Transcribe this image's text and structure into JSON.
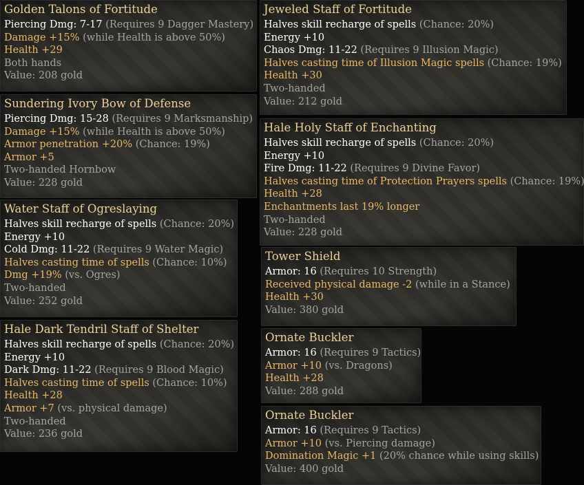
{
  "tooltips": [
    {
      "id": "golden-talons",
      "title": "Golden Talons of Fortitude",
      "lines": [
        [
          {
            "t": "Piercing Dmg: 7-17 ",
            "c": "w"
          },
          {
            "t": "(Requires 9 Dagger Mastery)",
            "c": "g"
          }
        ],
        [
          {
            "t": "Damage +15% ",
            "c": "o"
          },
          {
            "t": "(while Health is above 50%)",
            "c": "g"
          }
        ],
        [
          {
            "t": "Health +29",
            "c": "o"
          }
        ],
        [
          {
            "t": "Both hands",
            "c": "g"
          }
        ],
        [
          {
            "t": "Value: 208 gold",
            "c": "g"
          }
        ]
      ]
    },
    {
      "id": "sundering-ivory-bow",
      "title": "Sundering Ivory Bow of Defense",
      "lines": [
        [
          {
            "t": "Piercing Dmg: 15-28 ",
            "c": "w"
          },
          {
            "t": "(Requires 9 Marksmanship)",
            "c": "g"
          }
        ],
        [
          {
            "t": "Damage +15% ",
            "c": "o"
          },
          {
            "t": "(while Health is above 50%)",
            "c": "g"
          }
        ],
        [
          {
            "t": "Armor penetration +20% ",
            "c": "o"
          },
          {
            "t": "(Chance: 19%)",
            "c": "g"
          }
        ],
        [
          {
            "t": "Armor +5",
            "c": "o"
          }
        ],
        [
          {
            "t": "Two-handed Hornbow",
            "c": "g"
          }
        ],
        [
          {
            "t": "Value: 228 gold",
            "c": "g"
          }
        ]
      ]
    },
    {
      "id": "water-staff",
      "title": "Water Staff of Ogreslaying",
      "lines": [
        [
          {
            "t": "Halves skill recharge of spells ",
            "c": "w"
          },
          {
            "t": "(Chance: 20%)",
            "c": "g"
          }
        ],
        [
          {
            "t": "Energy +10",
            "c": "w"
          }
        ],
        [
          {
            "t": "Cold Dmg: 11-22 ",
            "c": "w"
          },
          {
            "t": "(Requires 9 Water Magic)",
            "c": "g"
          }
        ],
        [
          {
            "t": "Halves casting time of spells ",
            "c": "o"
          },
          {
            "t": "(Chance: 10%)",
            "c": "g"
          }
        ],
        [
          {
            "t": "Dmg +19% ",
            "c": "o"
          },
          {
            "t": "(vs. Ogres)",
            "c": "g"
          }
        ],
        [
          {
            "t": "Two-handed",
            "c": "g"
          }
        ],
        [
          {
            "t": "Value: 252 gold",
            "c": "g"
          }
        ]
      ]
    },
    {
      "id": "dark-tendril-staff",
      "title": "Hale Dark Tendril Staff of Shelter",
      "lines": [
        [
          {
            "t": "Halves skill recharge of spells ",
            "c": "w"
          },
          {
            "t": "(Chance: 20%)",
            "c": "g"
          }
        ],
        [
          {
            "t": "Energy +10",
            "c": "w"
          }
        ],
        [
          {
            "t": "Dark Dmg: 11-22 ",
            "c": "w"
          },
          {
            "t": "(Requires 9 Blood Magic)",
            "c": "g"
          }
        ],
        [
          {
            "t": "Halves casting time of spells ",
            "c": "o"
          },
          {
            "t": "(Chance: 10%)",
            "c": "g"
          }
        ],
        [
          {
            "t": "Health +28",
            "c": "o"
          }
        ],
        [
          {
            "t": "Armor +7 ",
            "c": "o"
          },
          {
            "t": "(vs. physical damage)",
            "c": "g"
          }
        ],
        [
          {
            "t": "Two-handed",
            "c": "g"
          }
        ],
        [
          {
            "t": "Value: 236 gold",
            "c": "g"
          }
        ]
      ]
    },
    {
      "id": "jeweled-staff",
      "title": "Jeweled Staff of Fortitude",
      "lines": [
        [
          {
            "t": "Halves skill recharge of spells ",
            "c": "w"
          },
          {
            "t": "(Chance: 20%)",
            "c": "g"
          }
        ],
        [
          {
            "t": "Energy +10",
            "c": "w"
          }
        ],
        [
          {
            "t": "Chaos Dmg: 11-22 ",
            "c": "w"
          },
          {
            "t": "(Requires 9 Illusion Magic)",
            "c": "g"
          }
        ],
        [
          {
            "t": "Halves casting time of Illusion Magic spells ",
            "c": "o"
          },
          {
            "t": "(Chance: 19%)",
            "c": "g"
          }
        ],
        [
          {
            "t": "Health +30",
            "c": "o"
          }
        ],
        [
          {
            "t": "Two-handed",
            "c": "g"
          }
        ],
        [
          {
            "t": "Value: 212 gold",
            "c": "g"
          }
        ]
      ]
    },
    {
      "id": "holy-staff",
      "title": "Hale Holy Staff of Enchanting",
      "lines": [
        [
          {
            "t": "Halves skill recharge of spells ",
            "c": "w"
          },
          {
            "t": "(Chance: 20%)",
            "c": "g"
          }
        ],
        [
          {
            "t": "Energy +10",
            "c": "w"
          }
        ],
        [
          {
            "t": "Fire Dmg: 11-22 ",
            "c": "w"
          },
          {
            "t": "(Requires 9 Divine Favor)",
            "c": "g"
          }
        ],
        [
          {
            "t": "Halves casting time of Protection Prayers spells ",
            "c": "o"
          },
          {
            "t": "(Chance: 19%)",
            "c": "g"
          }
        ],
        [
          {
            "t": "Health +28",
            "c": "o"
          }
        ],
        [
          {
            "t": "Enchantments last 19% longer",
            "c": "o"
          }
        ],
        [
          {
            "t": "Two-handed",
            "c": "g"
          }
        ],
        [
          {
            "t": "Value: 228 gold",
            "c": "g"
          }
        ]
      ]
    },
    {
      "id": "tower-shield",
      "title": "Tower Shield",
      "lines": [
        [
          {
            "t": "Armor: 16 ",
            "c": "w"
          },
          {
            "t": "(Requires 10 Strength)",
            "c": "g"
          }
        ],
        [
          {
            "t": "Received physical damage -2 ",
            "c": "o"
          },
          {
            "t": "(while in a Stance)",
            "c": "g"
          }
        ],
        [
          {
            "t": "Health +30",
            "c": "o"
          }
        ],
        [
          {
            "t": "Value: 380 gold",
            "c": "g"
          }
        ]
      ]
    },
    {
      "id": "ornate-buckler-1",
      "title": "Ornate Buckler",
      "lines": [
        [
          {
            "t": "Armor: 16 ",
            "c": "w"
          },
          {
            "t": "(Requires 9 Tactics)",
            "c": "g"
          }
        ],
        [
          {
            "t": "Armor +10 ",
            "c": "o"
          },
          {
            "t": "(vs. Dragons)",
            "c": "g"
          }
        ],
        [
          {
            "t": "Health +28",
            "c": "o"
          }
        ],
        [
          {
            "t": "Value: 288 gold",
            "c": "g"
          }
        ]
      ]
    },
    {
      "id": "ornate-buckler-2",
      "title": "Ornate Buckler",
      "lines": [
        [
          {
            "t": "Armor: 16 ",
            "c": "w"
          },
          {
            "t": "(Requires 9 Tactics)",
            "c": "g"
          }
        ],
        [
          {
            "t": "Armor +10 ",
            "c": "o"
          },
          {
            "t": "(vs. Piercing damage)",
            "c": "g"
          }
        ],
        [
          {
            "t": "Domination Magic +1 ",
            "c": "o"
          },
          {
            "t": "(20% chance while using skills)",
            "c": "g"
          }
        ],
        [
          {
            "t": "Value: 400 gold",
            "c": "g"
          }
        ]
      ]
    }
  ]
}
